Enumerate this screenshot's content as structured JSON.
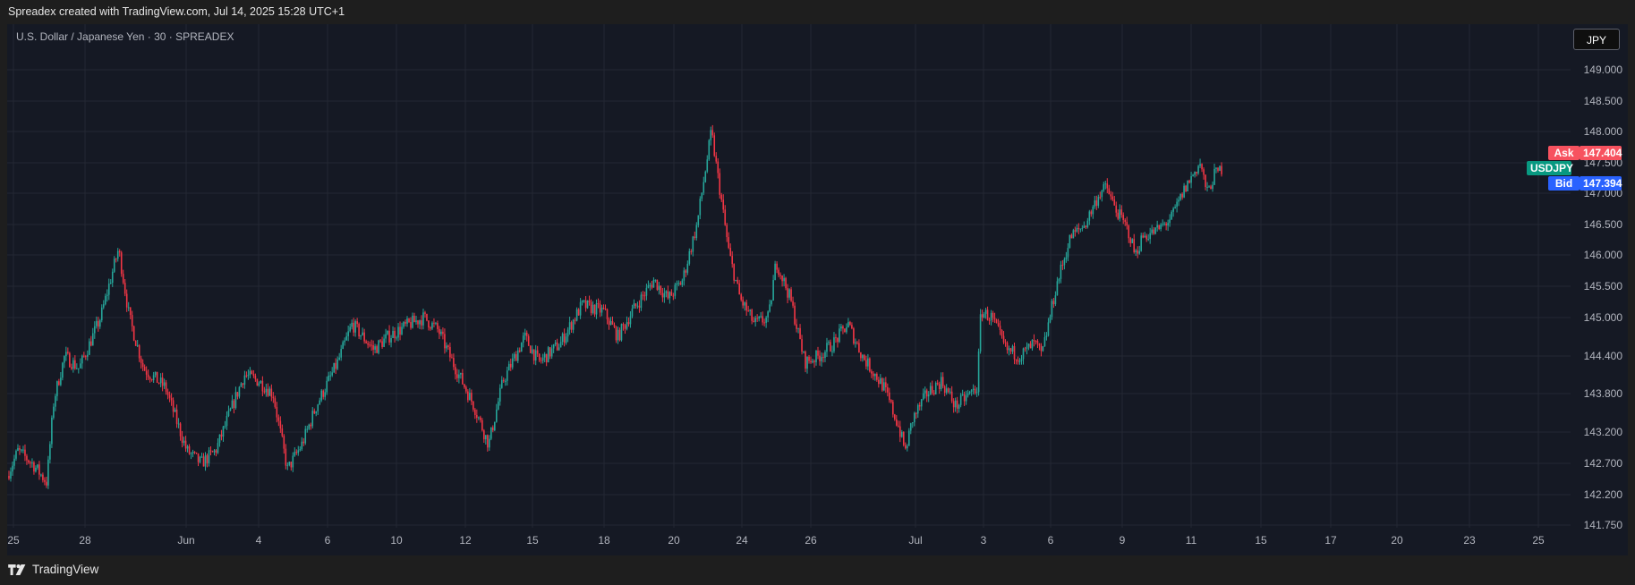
{
  "header": {
    "attribution": "Spreadex created with TradingView.com, Jul 14, 2025 15:28 UTC+1"
  },
  "legend": {
    "symbol_line": "U.S. Dollar / Japanese Yen · 30 · SPREADEX"
  },
  "currency_button": {
    "label": "JPY"
  },
  "price_tags": {
    "ask": {
      "label": "Ask",
      "value": "147.404",
      "color": "#f7525f"
    },
    "symbol": {
      "label": "USDJPY",
      "color": "#089981"
    },
    "bid": {
      "label": "Bid",
      "value": "147.394",
      "color": "#2962ff"
    }
  },
  "footer": {
    "brand": "TradingView"
  },
  "colors": {
    "up": "#26a69a",
    "down": "#f23645",
    "grid": "#242733",
    "axis_text": "#b2b5be",
    "background": "#151924"
  },
  "chart_data": {
    "type": "candlestick",
    "title": "U.S. Dollar / Japanese Yen · 30 · SPREADEX",
    "interval": "30",
    "ylim": [
      141.5,
      149.3
    ],
    "y_ticks": [
      "149.000",
      "148.500",
      "148.000",
      "147.500",
      "147.000",
      "146.500",
      "146.000",
      "145.500",
      "145.000",
      "144.400",
      "143.800",
      "143.200",
      "142.700",
      "142.200",
      "141.750"
    ],
    "x_ticks": [
      "25",
      "28",
      "Jun",
      "4",
      "6",
      "10",
      "12",
      "15",
      "18",
      "20",
      "24",
      "26",
      "Jul",
      "3",
      "6",
      "9",
      "11",
      "15",
      "17",
      "20",
      "23",
      "25"
    ],
    "grid": true,
    "series": [
      {
        "name": "USDJPY",
        "approx_close_path": [
          [
            0,
            142.5
          ],
          [
            1.5,
            142.9
          ],
          [
            3.5,
            142.7
          ],
          [
            5.5,
            142.4
          ],
          [
            6.5,
            143.7
          ],
          [
            8,
            144.4
          ],
          [
            10,
            144.2
          ],
          [
            13,
            145.0
          ],
          [
            15.5,
            146.1
          ],
          [
            17,
            145.0
          ],
          [
            19,
            144.2
          ],
          [
            22,
            143.9
          ],
          [
            25,
            142.9
          ],
          [
            27,
            142.7
          ],
          [
            29,
            142.9
          ],
          [
            31,
            143.5
          ],
          [
            33,
            144.1
          ],
          [
            35,
            144.0
          ],
          [
            37,
            143.8
          ],
          [
            39,
            142.6
          ],
          [
            41,
            143.0
          ],
          [
            43,
            143.6
          ],
          [
            46,
            144.3
          ],
          [
            48,
            144.9
          ],
          [
            51,
            144.5
          ],
          [
            53,
            144.7
          ],
          [
            56,
            144.9
          ],
          [
            58,
            145.0
          ],
          [
            60,
            144.8
          ],
          [
            62,
            144.3
          ],
          [
            65,
            143.6
          ],
          [
            67,
            143.0
          ],
          [
            69,
            144.0
          ],
          [
            72,
            144.7
          ],
          [
            74,
            144.3
          ],
          [
            77,
            144.6
          ],
          [
            80,
            145.2
          ],
          [
            83,
            145.1
          ],
          [
            85,
            144.7
          ],
          [
            87,
            145.1
          ],
          [
            90,
            145.6
          ],
          [
            92,
            145.3
          ],
          [
            94,
            145.6
          ],
          [
            96,
            146.5
          ],
          [
            98,
            148.0
          ],
          [
            99,
            147.2
          ],
          [
            100.5,
            146.0
          ],
          [
            102,
            145.3
          ],
          [
            104,
            144.9
          ],
          [
            106,
            145.0
          ],
          [
            107,
            145.9
          ],
          [
            109,
            145.3
          ],
          [
            111,
            144.3
          ],
          [
            113,
            144.4
          ],
          [
            115,
            144.6
          ],
          [
            117,
            144.9
          ],
          [
            119,
            144.4
          ],
          [
            122,
            143.9
          ],
          [
            124,
            143.3
          ],
          [
            125,
            142.9
          ],
          [
            126,
            143.4
          ],
          [
            128,
            143.8
          ],
          [
            130,
            144.0
          ],
          [
            132,
            143.6
          ],
          [
            134,
            143.8
          ],
          [
            135,
            143.9
          ],
          [
            135.5,
            145.1
          ],
          [
            137,
            145.0
          ],
          [
            139,
            144.5
          ],
          [
            141,
            144.4
          ],
          [
            143,
            144.6
          ],
          [
            144,
            144.4
          ],
          [
            146,
            145.5
          ],
          [
            148,
            146.3
          ],
          [
            150,
            146.5
          ],
          [
            152,
            147.0
          ],
          [
            153,
            147.1
          ],
          [
            154,
            146.8
          ],
          [
            156,
            146.4
          ],
          [
            157,
            146.0
          ],
          [
            158,
            146.3
          ],
          [
            160,
            146.4
          ],
          [
            162,
            146.6
          ],
          [
            164,
            147.1
          ],
          [
            166,
            147.5
          ],
          [
            167,
            147.0
          ],
          [
            168,
            147.3
          ],
          [
            169,
            147.404
          ]
        ]
      }
    ]
  }
}
